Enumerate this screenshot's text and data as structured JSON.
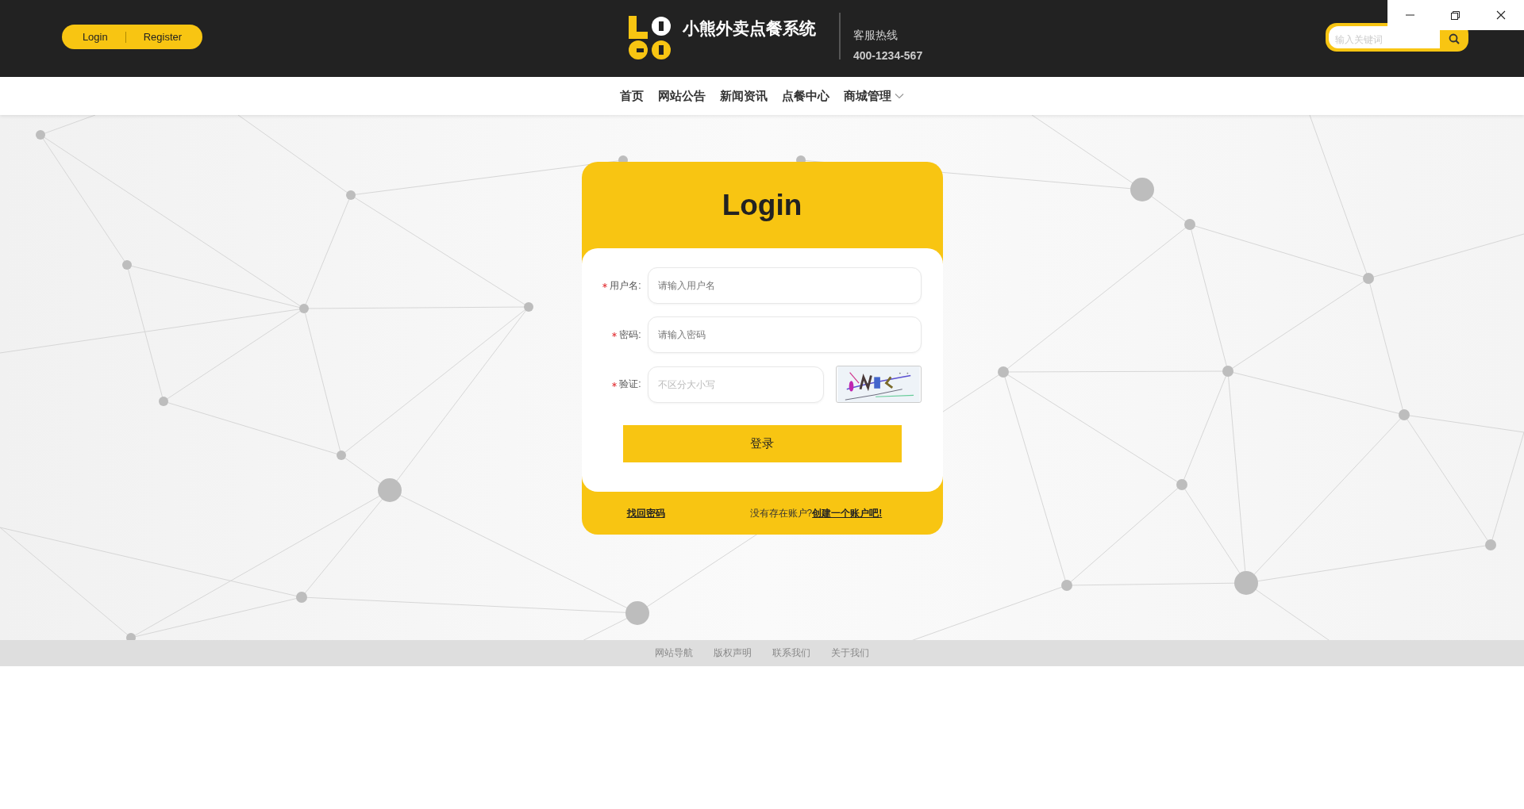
{
  "header": {
    "auth_links": [
      "Login",
      "Register"
    ],
    "site_title": "小熊外卖点餐系统",
    "hotline_label": "客服热线",
    "hotline_number": "400-1234-567",
    "search": {
      "placeholder": "输入关键词"
    }
  },
  "nav": [
    {
      "label": "首页",
      "has_dropdown": false
    },
    {
      "label": "网站公告",
      "has_dropdown": false
    },
    {
      "label": "新闻资讯",
      "has_dropdown": false
    },
    {
      "label": "点餐中心",
      "has_dropdown": false
    },
    {
      "label": "商城管理",
      "has_dropdown": true
    }
  ],
  "login": {
    "title": "Login",
    "fields": [
      {
        "kind": "text",
        "label": "用户名:",
        "required": true,
        "placeholder": "请输入用户名"
      },
      {
        "kind": "password",
        "label": "密码:",
        "required": true,
        "placeholder": "请输入密码"
      },
      {
        "kind": "captcha",
        "label": "验证:",
        "required": true,
        "placeholder": "不区分大小写"
      }
    ],
    "submit": "登录",
    "forgot_link": "找回密码",
    "register_prompt": "没有存在账户?",
    "register_link": "创建一个账户吧!"
  },
  "footer": {
    "links": [
      "网站导航",
      "版权声明",
      "联系我们",
      "关于我们"
    ]
  }
}
